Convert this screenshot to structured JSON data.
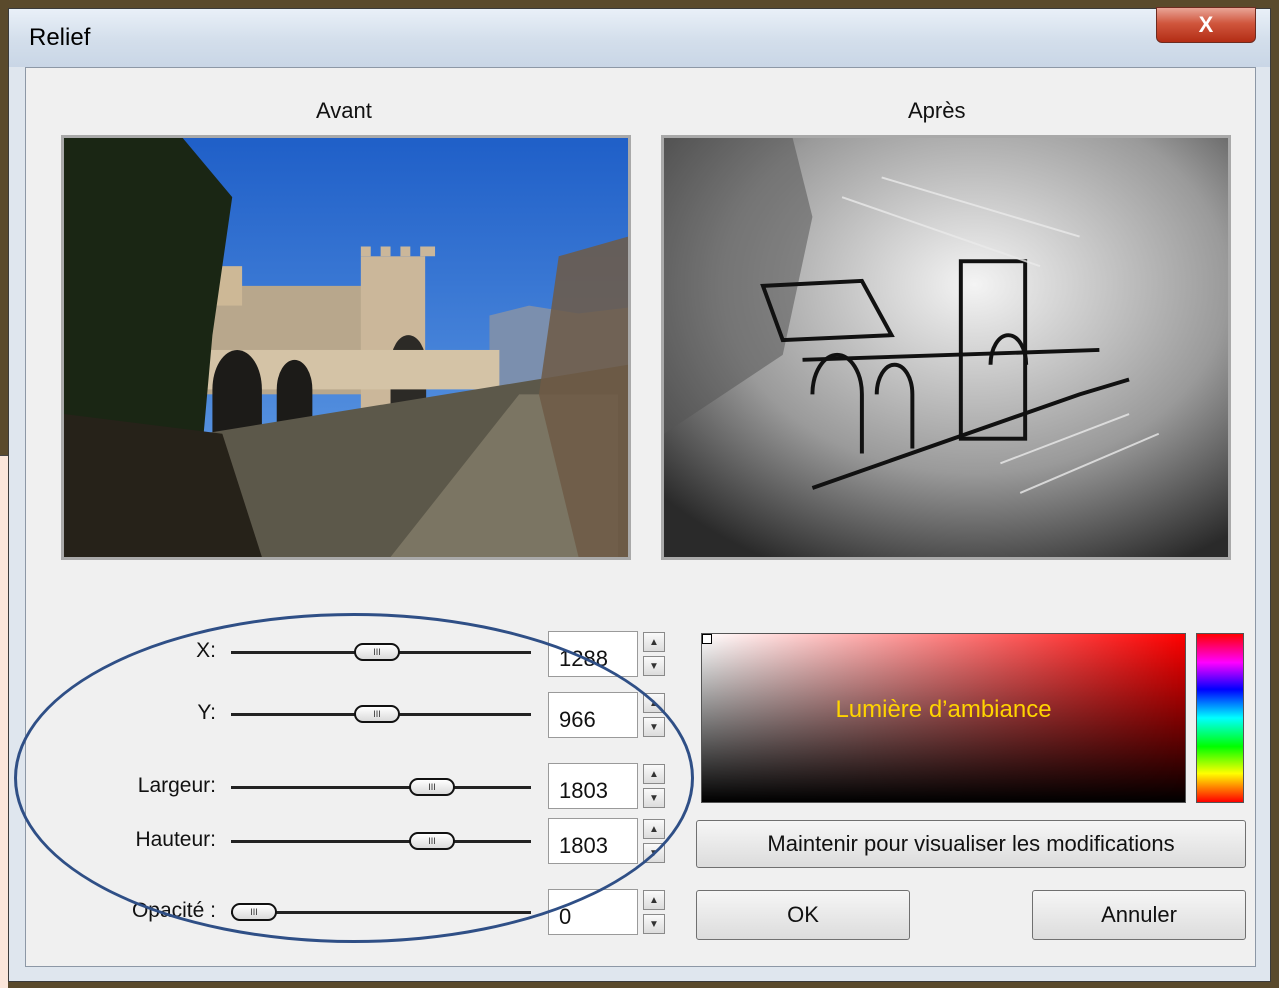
{
  "window": {
    "title": "Relief",
    "close_label": "X"
  },
  "preview": {
    "before_label": "Avant",
    "after_label": "Après"
  },
  "sliders": [
    {
      "label": "X:",
      "value": "1288",
      "level": 0.5
    },
    {
      "label": "Y:",
      "value": "966",
      "level": 0.5
    },
    {
      "label": "Largeur:",
      "value": "1803",
      "level": 0.7
    },
    {
      "label": "Hauteur:",
      "value": "1803",
      "level": 0.7
    },
    {
      "label": "Opacité :",
      "value": "0",
      "level": 0.0
    }
  ],
  "color_picker": {
    "label": "Lumière d’ambiance"
  },
  "buttons": {
    "preview": "Maintenir pour visualiser les modifications",
    "ok": "OK",
    "cancel": "Annuler"
  },
  "colors": {
    "annotation": "#2f4f86",
    "picker_text": "#ffd400",
    "close": "#c8432b"
  }
}
